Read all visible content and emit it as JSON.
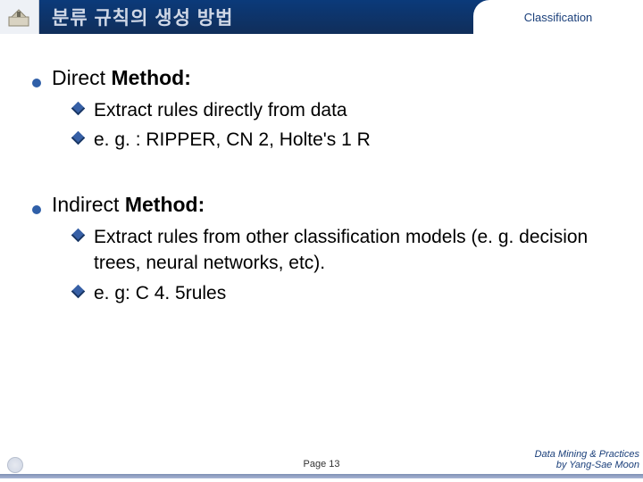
{
  "header": {
    "title": "분류 규칙의 생성 방법",
    "tag": "Classification"
  },
  "content": {
    "sections": [
      {
        "heading_prefix": "Direct",
        "heading_suffix": " Method:",
        "subs": [
          "Extract rules directly from data",
          "e. g. : RIPPER, CN 2, Holte's 1 R"
        ]
      },
      {
        "heading_prefix": "Indirect",
        "heading_suffix": " Method:",
        "subs": [
          "Extract rules from other classification models (e. g. decision trees, neural networks, etc).",
          "e. g: C 4. 5rules"
        ]
      }
    ]
  },
  "footer": {
    "page": "Page 13",
    "credit_line1": "Data Mining & Practices",
    "credit_line2": "by Yang-Sae Moon"
  }
}
